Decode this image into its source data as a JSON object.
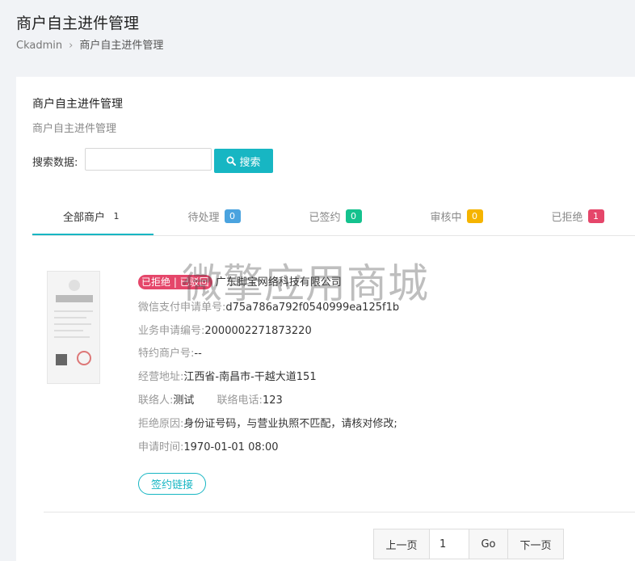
{
  "header": {
    "title": "商户自主进件管理",
    "breadcrumb": {
      "root": "Ckadmin",
      "separator": "›",
      "current": "商户自主进件管理"
    }
  },
  "card": {
    "title": "商户自主进件管理",
    "subtitle": "商户自主进件管理"
  },
  "search": {
    "label": "搜索数据:",
    "value": "",
    "button_label": "搜索",
    "button_color": "#17b6c3"
  },
  "tabs": [
    {
      "label": "全部商户",
      "count": "1",
      "active": true
    },
    {
      "label": "待处理",
      "count": "0",
      "color": "#4aa3df"
    },
    {
      "label": "已签约",
      "count": "0",
      "color": "#14c28e"
    },
    {
      "label": "审核中",
      "count": "0",
      "color": "#f5b400"
    },
    {
      "label": "已拒绝",
      "count": "1",
      "color": "#e5466a"
    }
  ],
  "merchant": {
    "status": "已拒绝 | 已驳回",
    "company": "广东脚宝网络科技有限公司",
    "fields": {
      "wechat_apply_no": {
        "label": "微信支付申请单号:",
        "value": "d75a786a792f0540999ea125f1b"
      },
      "business_apply_no": {
        "label": "业务申请编号:",
        "value": "2000002271873220"
      },
      "sub_merchant_no": {
        "label": "特约商户号:",
        "value": "--"
      },
      "address": {
        "label": "经营地址:",
        "value": "江西省-南昌市-干越大道151"
      },
      "contact": {
        "label": "联络人:",
        "value": "测试"
      },
      "phone": {
        "label": "联络电话:",
        "value": "123"
      },
      "reject_reason": {
        "label": "拒绝原因:",
        "value": "身份证号码，与营业执照不匹配，请核对修改;"
      },
      "apply_time": {
        "label": "申请时间:",
        "value": "1970-01-01 08:00"
      }
    },
    "sign_link_label": "签约链接"
  },
  "watermark": "微擎应用商城",
  "pagination": {
    "prev_label": "上一页",
    "page_value": "1",
    "go_label": "Go",
    "next_label": "下一页"
  }
}
